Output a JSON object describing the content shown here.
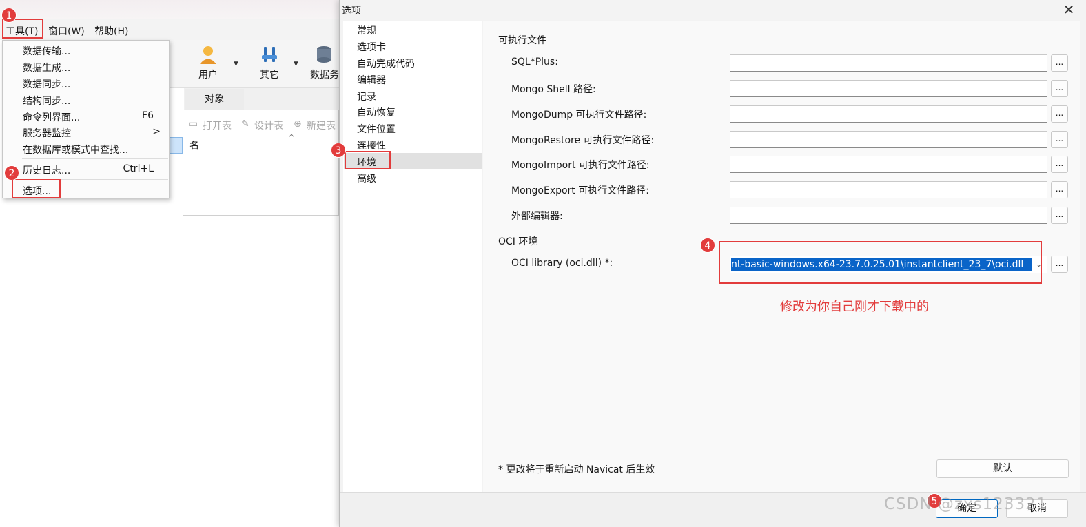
{
  "background_window": {
    "menu": {
      "tools": "工具(T)",
      "window": "窗口(W)",
      "help": "帮助(H)"
    },
    "toolbar": {
      "user": "用户",
      "other": "其它",
      "data_partial": "数据务"
    },
    "object_tab": "对象",
    "object_toolbar": {
      "open_table": "打开表",
      "design_table": "设计表",
      "new_table": "新建表"
    },
    "column_name": "名"
  },
  "tools_menu": {
    "items": [
      {
        "label": "数据传输...",
        "shortcut": ""
      },
      {
        "label": "数据生成...",
        "shortcut": ""
      },
      {
        "label": "数据同步...",
        "shortcut": ""
      },
      {
        "label": "结构同步...",
        "shortcut": ""
      },
      {
        "label": "命令列界面...",
        "shortcut": "F6"
      },
      {
        "label": "服务器监控",
        "shortcut": ">"
      },
      {
        "label": "在数据库或模式中查找...",
        "shortcut": ""
      },
      {
        "label": "历史日志...",
        "shortcut": "Ctrl+L"
      },
      {
        "label": "选项...",
        "shortcut": ""
      }
    ]
  },
  "dialog": {
    "title": "选项",
    "close": "✕",
    "nav": [
      "常规",
      "选项卡",
      "自动完成代码",
      "编辑器",
      "记录",
      "自动恢复",
      "文件位置",
      "连接性",
      "环境",
      "高级"
    ],
    "sections": {
      "executables": "可执行文件",
      "oci": "OCI 环境"
    },
    "fields": [
      {
        "label": "SQL*Plus:",
        "value": ""
      },
      {
        "label": "Mongo Shell 路径:",
        "value": ""
      },
      {
        "label": "MongoDump 可执行文件路径:",
        "value": ""
      },
      {
        "label": "MongoRestore 可执行文件路径:",
        "value": ""
      },
      {
        "label": "MongoImport 可执行文件路径:",
        "value": ""
      },
      {
        "label": "MongoExport 可执行文件路径:",
        "value": ""
      },
      {
        "label": "外部编辑器:",
        "value": ""
      }
    ],
    "browse_label": "...",
    "oci": {
      "label": "OCI library (oci.dll) *:",
      "value": "nt-basic-windows.x64-23.7.0.25.01\\instantclient_23_7\\oci.dll"
    },
    "note": "* 更改将于重新启动 Navicat 后生效",
    "buttons": {
      "default": "默认",
      "ok": "确定",
      "cancel": "取消"
    }
  },
  "annotations": {
    "badges": [
      "1",
      "2",
      "3",
      "4",
      "5"
    ],
    "note": "修改为你自己刚才下载中的"
  },
  "watermark": "CSDN @zxs123321",
  "colors": {
    "annotation_red": "#e23c3c",
    "selection_blue": "#0a64c8"
  }
}
